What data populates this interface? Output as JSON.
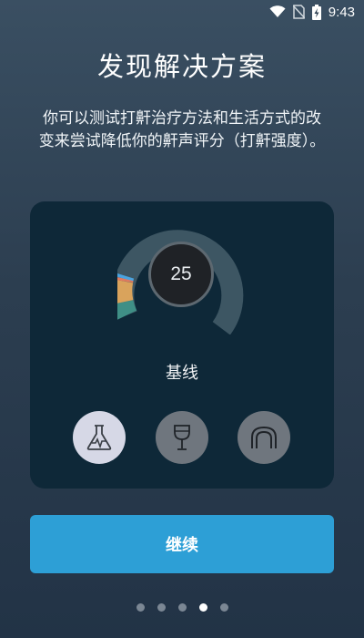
{
  "status_bar": {
    "time": "9:43",
    "icons": [
      "wifi-icon",
      "no-sim-icon",
      "battery-charging-icon"
    ]
  },
  "page": {
    "title": "发现解决方案",
    "description": "你可以测试打鼾治疗方法和生活方式的改变来尝试降低你的鼾声评分（打鼾强度）。"
  },
  "card": {
    "score": "25",
    "label": "基线",
    "gauge": {
      "segments": [
        {
          "color": "#3f8f86",
          "name": "segment-teal"
        },
        {
          "color": "#d9a35c",
          "name": "segment-orange"
        },
        {
          "color": "#e07a5f",
          "name": "segment-red"
        },
        {
          "color": "#4aa3df",
          "name": "segment-blue"
        }
      ],
      "track_color": "#3d5663"
    },
    "icons": [
      {
        "name": "lab-flask-icon",
        "active": true
      },
      {
        "name": "wine-glass-icon",
        "active": false
      },
      {
        "name": "mouthguard-icon",
        "active": false
      }
    ]
  },
  "continue_button": {
    "label": "继续"
  },
  "pager": {
    "count": 5,
    "active_index": 3
  },
  "colors": {
    "accent": "#2d9fd6",
    "card_bg": "#0e2838",
    "active_icon_bg": "#d6d8e6",
    "inactive_icon_bg": "#6f767e"
  }
}
